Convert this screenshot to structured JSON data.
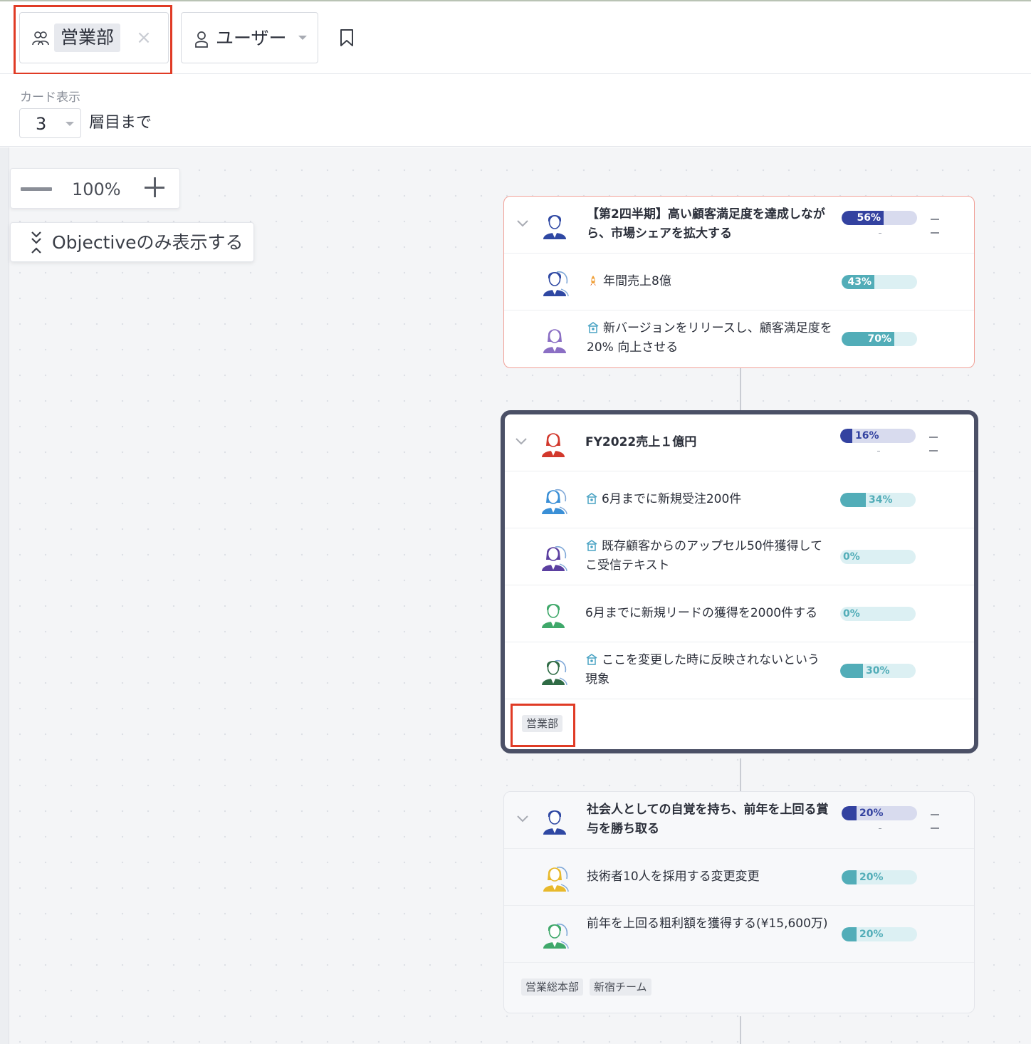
{
  "filters": {
    "department": {
      "value": "営業部",
      "clear_symbol": "×"
    },
    "user": {
      "label": "ユーザー"
    }
  },
  "display": {
    "title": "カード表示",
    "depth_value": "3",
    "depth_suffix": "層目まで"
  },
  "zoom": {
    "level": "100%"
  },
  "objective_toggle": {
    "label": "Objectiveのみ表示する"
  },
  "colors": {
    "objective_bar": "#3342a0",
    "objective_track": "#d8dbee",
    "kr_bar": "#52adb8",
    "kr_track": "#dcf0f3",
    "highlight": "#e03b25",
    "selected_border": "#4b5066"
  },
  "cards": [
    {
      "objective": {
        "title": "【第2四半期】高い顧客満足度を達成しながら、市場シェアを拡大する",
        "progress": 56,
        "progress_label": "56%",
        "avatar": "male-blue-avatar"
      },
      "key_results": [
        {
          "title": "年間売上8億",
          "progress": 43,
          "progress_label": "43%",
          "avatar": "male-blue-avatar",
          "icon": "rocket-icon"
        },
        {
          "title": "新バージョンをリリースし、顧客満足度を20% 向上させる",
          "progress": 70,
          "progress_label": "70%",
          "avatar": "female-purple-avatar",
          "icon": "kr-icon"
        }
      ],
      "tags": []
    },
    {
      "objective": {
        "title": "FY2022売上１億円",
        "progress": 16,
        "progress_label": "16%",
        "avatar": "female-red-avatar"
      },
      "key_results": [
        {
          "title": "6月までに新規受注200件",
          "progress": 34,
          "progress_label": "34%",
          "avatar": "female-blue-avatar",
          "icon": "kr-icon"
        },
        {
          "title": "既存顧客からのアップセル50件獲得してこ受信テキスト",
          "progress": 0,
          "progress_label": "0%",
          "avatar": "female-purple-avatar",
          "icon": "kr-icon"
        },
        {
          "title": "6月までに新規リードの獲得を2000件する",
          "progress": 0,
          "progress_label": "0%",
          "avatar": "male-green-avatar",
          "icon": ""
        },
        {
          "title": "ここを変更した時に反映されないという現象",
          "progress": 30,
          "progress_label": "30%",
          "avatar": "male-darkgreen-avatar",
          "icon": "kr-icon"
        }
      ],
      "tags": [
        "営業部"
      ]
    },
    {
      "objective": {
        "title": "社会人としての自覚を持ち、前年を上回る賞与を勝ち取る",
        "progress": 20,
        "progress_label": "20%",
        "avatar": "male-blue-avatar"
      },
      "key_results": [
        {
          "title": "技術者10人を採用する変更変更",
          "progress": 20,
          "progress_label": "20%",
          "avatar": "female-yellow-avatar",
          "icon": ""
        },
        {
          "title": "前年を上回る粗利額を獲得する(¥15,600万)",
          "progress": 20,
          "progress_label": "20%",
          "avatar": "male-green-avatar",
          "icon": ""
        }
      ],
      "tags": [
        "営業総本部",
        "新宿チーム"
      ]
    }
  ]
}
